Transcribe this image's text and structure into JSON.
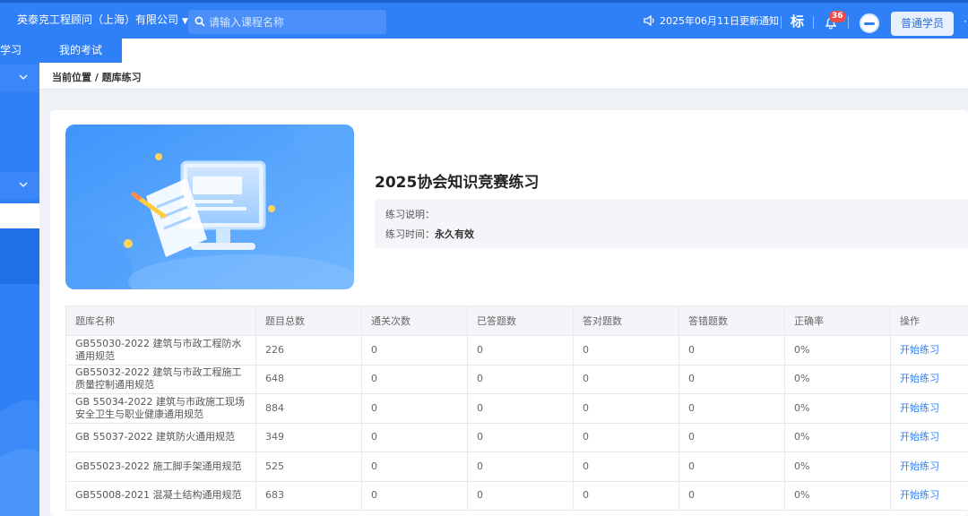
{
  "header": {
    "company": "英泰克工程顾问（上海）有限公司",
    "search_placeholder": "请输入课程名称",
    "notice": "2025年06月11日更新通知",
    "mark_label": "标",
    "notification_count": "36",
    "role_button": "普通学员"
  },
  "nav": {
    "left_partial_label": "学习",
    "active_tab": "我的考试"
  },
  "breadcrumb": "当前位置 / 题库练习",
  "practice": {
    "title": "2025协会知识竞赛练习",
    "desc_label": "练习说明：",
    "desc_value": "",
    "time_label": "练习时间：",
    "time_value": "永久有效"
  },
  "table": {
    "columns": [
      "题库名称",
      "题目总数",
      "通关次数",
      "已答题数",
      "答对题数",
      "答错题数",
      "正确率",
      "操作"
    ],
    "rows": [
      {
        "name": "GB55030-2022 建筑与市政工程防水通用规范",
        "total": "226",
        "passes": "0",
        "answered": "0",
        "correct": "0",
        "wrong": "0",
        "rate": "0%",
        "action": "开始练习"
      },
      {
        "name": "GB55032-2022 建筑与市政工程施工质量控制通用规范",
        "total": "648",
        "passes": "0",
        "answered": "0",
        "correct": "0",
        "wrong": "0",
        "rate": "0%",
        "action": "开始练习"
      },
      {
        "name": "GB 55034-2022 建筑与市政施工现场安全卫生与职业健康通用规范",
        "total": "884",
        "passes": "0",
        "answered": "0",
        "correct": "0",
        "wrong": "0",
        "rate": "0%",
        "action": "开始练习"
      },
      {
        "name": "GB 55037-2022 建筑防火通用规范",
        "total": "349",
        "passes": "0",
        "answered": "0",
        "correct": "0",
        "wrong": "0",
        "rate": "0%",
        "action": "开始练习"
      },
      {
        "name": "GB55023-2022 施工脚手架通用规范",
        "total": "525",
        "passes": "0",
        "answered": "0",
        "correct": "0",
        "wrong": "0",
        "rate": "0%",
        "action": "开始练习"
      },
      {
        "name": "GB55008-2021 混凝土结构通用规范",
        "total": "683",
        "passes": "0",
        "answered": "0",
        "correct": "0",
        "wrong": "0",
        "rate": "0%",
        "action": "开始练习"
      }
    ]
  },
  "colors": {
    "primary": "#2f7ff7",
    "header_border": "#1c5fd1",
    "badge": "#f04b4b",
    "page_bg": "#eef1f5"
  },
  "icons": {
    "search": "search-icon",
    "notice": "speaker-icon",
    "bell": "bell-icon",
    "caret": "caret-down-icon"
  }
}
